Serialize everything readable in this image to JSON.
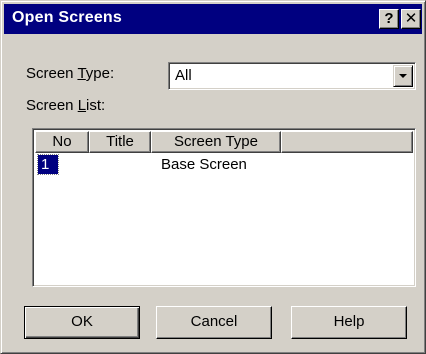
{
  "window": {
    "title": "Open Screens",
    "help_button": "?",
    "close_button": "✕"
  },
  "screen_type": {
    "label_prefix": "Screen ",
    "label_accel": "T",
    "label_suffix": "ype:",
    "selected": "All"
  },
  "screen_list": {
    "label_prefix": "Screen ",
    "label_accel": "L",
    "label_suffix": "ist:",
    "columns": [
      "No",
      "Title",
      "Screen Type",
      ""
    ],
    "rows": [
      {
        "no": "1",
        "title": "",
        "type": "Base Screen",
        "selected": true
      }
    ]
  },
  "buttons": {
    "ok": "OK",
    "cancel": "Cancel",
    "help": "Help"
  },
  "colors": {
    "face": "#d4d0c8",
    "titlebar": "#000080",
    "selection": "#000080"
  }
}
